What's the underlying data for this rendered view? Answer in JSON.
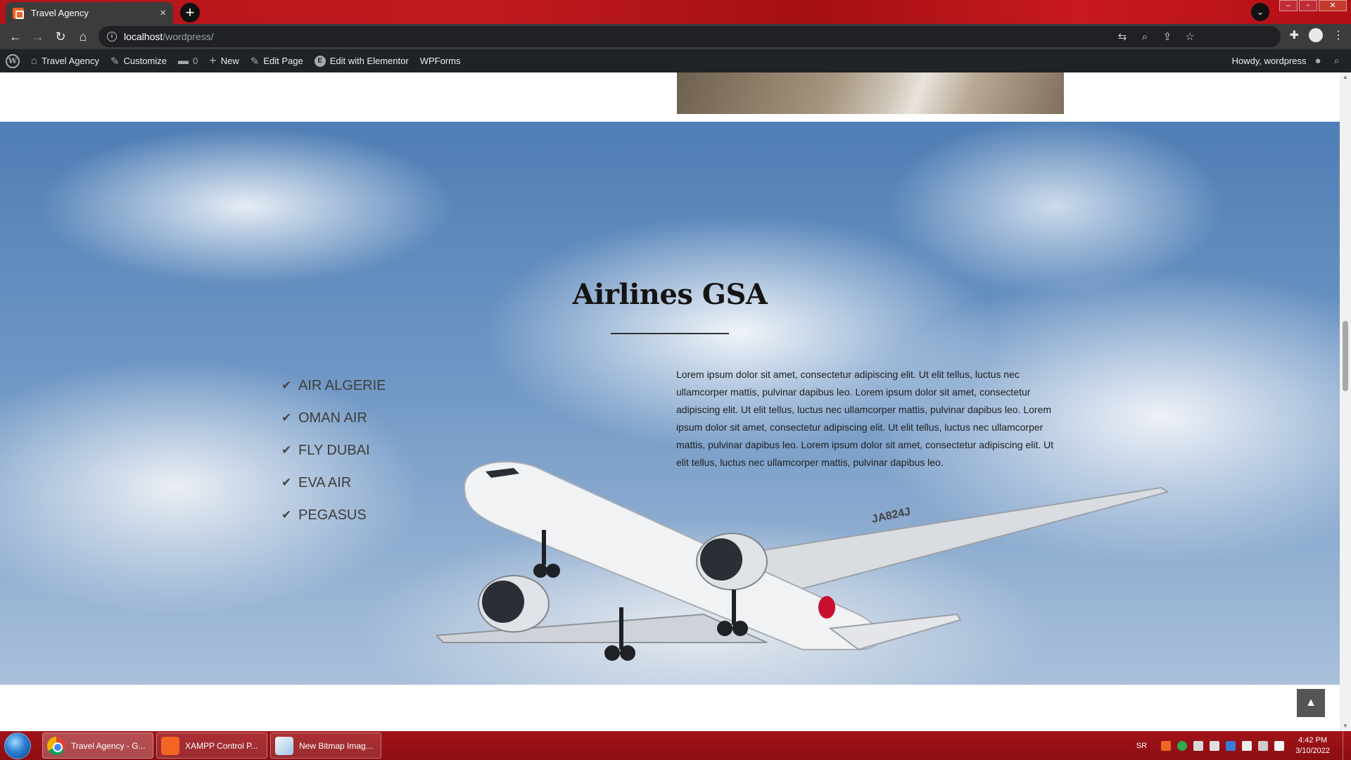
{
  "browser": {
    "tab_title": "Travel Agency",
    "tab_close": "×",
    "new_tab": "+",
    "tab_menu": "⌄",
    "window_buttons": {
      "minimize": "–",
      "maximize": "▫",
      "close": "✕"
    },
    "nav": {
      "back": "←",
      "forward": "→",
      "reload": "↻",
      "home": "⌂"
    },
    "address": {
      "host": "localhost",
      "path": "/wordpress/"
    },
    "omnibox_icons": {
      "translate": "⇆",
      "zoom": "⌕",
      "share": "⇪",
      "bookmark": "☆"
    },
    "toolbar_icons": {
      "extensions": "✚",
      "menu": "⋮"
    }
  },
  "adminbar": {
    "site_name": "Travel Agency",
    "customize": "Customize",
    "comments_count": "0",
    "new": "New",
    "edit_page": "Edit Page",
    "edit_elementor": "Edit with Elementor",
    "wpforms": "WPForms",
    "howdy": "Howdy, wordpress",
    "icons": {
      "wp_logo": "W",
      "site": "⌂",
      "customize": "✎",
      "comments": "▬",
      "new": "+",
      "edit": "✎",
      "elementor": "E",
      "search": "⌕",
      "user": "●"
    }
  },
  "hero": {
    "title": "Airlines GSA",
    "airlines": [
      "AIR ALGERIE",
      "OMAN AIR",
      "FLY DUBAI",
      "EVA AIR",
      "PEGASUS"
    ],
    "check_icon": "✔",
    "description": "Lorem ipsum dolor sit amet, consectetur adipiscing elit. Ut elit tellus, luctus nec ullamcorper mattis, pulvinar dapibus leo. Lorem ipsum dolor sit amet, consectetur adipiscing elit. Ut elit tellus, luctus nec ullamcorper mattis, pulvinar dapibus leo. Lorem ipsum dolor sit amet, consectetur adipiscing elit. Ut elit tellus, luctus nec ullamcorper mattis, pulvinar dapibus leo. Lorem ipsum dolor sit amet, consectetur adipiscing elit. Ut elit tellus, luctus nec ullamcorper mattis, pulvinar dapibus leo.",
    "plane_registration": "JA824J"
  },
  "scroll_top_icon": "▲",
  "taskbar": {
    "items": [
      {
        "label": "Travel Agency - G...",
        "icon": "chrome-icon"
      },
      {
        "label": "XAMPP Control P...",
        "icon": "xampp-icon"
      },
      {
        "label": "New Bitmap Imag...",
        "icon": "paint-icon"
      }
    ],
    "language": "SR",
    "time": "4:42 PM",
    "date": "3/10/2022"
  },
  "colors": {
    "tabbar_red": "#b3141a",
    "chrome_dark": "#3c3c3c",
    "adminbar": "#1d2327",
    "taskbar_red": "#8c0d12",
    "sky_blue": "#4f7eb5"
  }
}
